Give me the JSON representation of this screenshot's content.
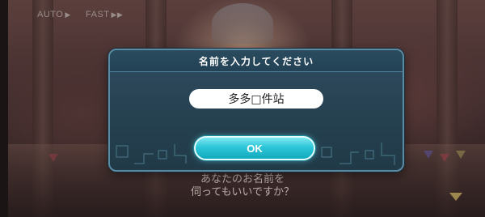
{
  "top_controls": {
    "auto_label": "AUTO",
    "fast_label": "FAST"
  },
  "dialog": {
    "title": "名前を入力してください",
    "name_value": "多多□件站",
    "ok_label": "OK"
  },
  "hint": {
    "line1": "あなたのお名前を",
    "line2": "伺ってもいいですか？"
  },
  "colors": {
    "dialog_bg": "#25404f",
    "dialog_border": "#5b8aa2",
    "ok_button": "#2cc6d8",
    "field_bg": "#ffffff"
  },
  "icons": {
    "auto": "play-arrow-icon",
    "fast": "fast-forward-icon",
    "corner": "down-triangle-icon"
  }
}
